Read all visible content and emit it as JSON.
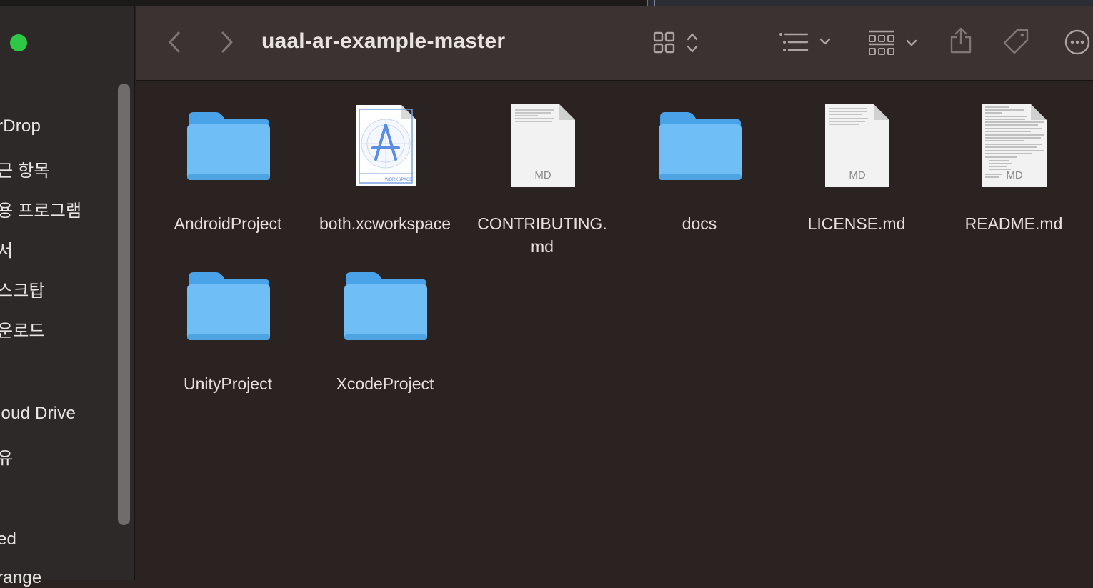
{
  "window": {
    "title": "uaal-ar-example-master"
  },
  "sidebar": {
    "items": [
      {
        "label": "rDrop"
      },
      {
        "label": "근 항목"
      },
      {
        "label": "용 프로그램"
      },
      {
        "label": "서"
      },
      {
        "label": "스크탑"
      },
      {
        "label": "운로드"
      },
      {
        "label": "loud Drive"
      },
      {
        "label": "유"
      },
      {
        "label": "ed"
      },
      {
        "label": "range"
      }
    ]
  },
  "toolbar": {
    "icons": [
      "back-icon",
      "forward-icon",
      "icon-view-icon",
      "list-view-icon",
      "group-icon",
      "share-icon",
      "tag-icon",
      "more-icon"
    ]
  },
  "files": [
    {
      "name": "AndroidProject",
      "kind": "folder"
    },
    {
      "name": "both.xcworkspace",
      "kind": "workspace",
      "badge": "WORKSPACE"
    },
    {
      "name": "CONTRIBUTING.\nmd",
      "kind": "md",
      "badge": "MD"
    },
    {
      "name": "docs",
      "kind": "folder"
    },
    {
      "name": "LICENSE.md",
      "kind": "md",
      "badge": "MD"
    },
    {
      "name": "README.md",
      "kind": "md",
      "badge": "MD"
    },
    {
      "name": "UnityProject",
      "kind": "folder"
    },
    {
      "name": "XcodeProject",
      "kind": "folder"
    }
  ],
  "colors": {
    "folder": "#6fbef6",
    "folder_tab": "#4aa3e8",
    "window_bg": "#2a2322",
    "toolbar_bg": "#3a3332",
    "sidebar_bg": "#2d2929",
    "traffic_green": "#2dc845"
  }
}
